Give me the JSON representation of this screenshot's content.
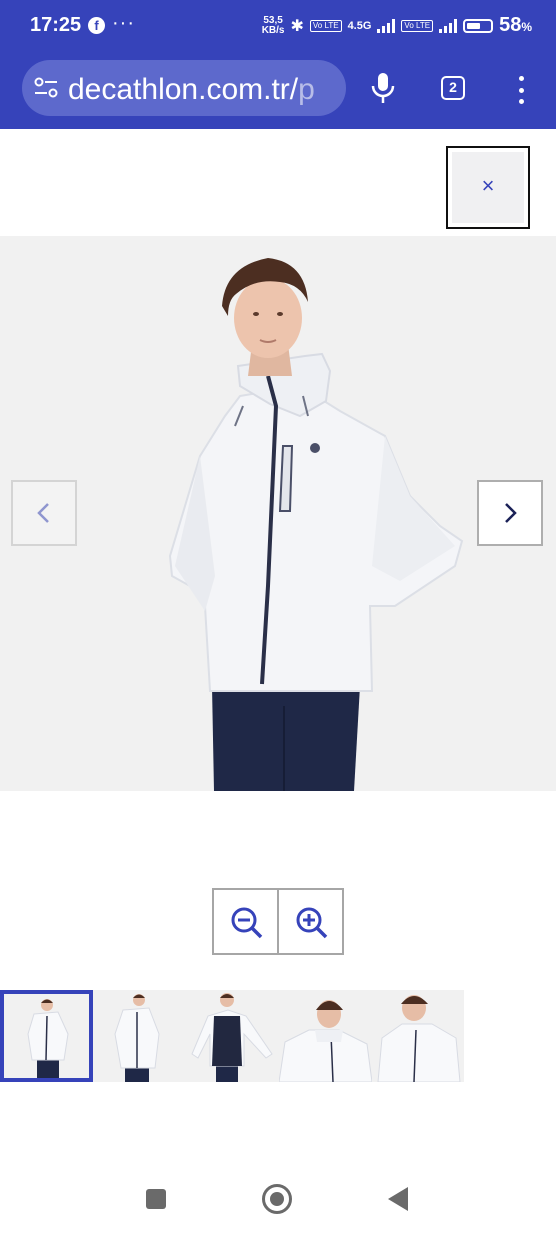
{
  "status_bar": {
    "time": "17:25",
    "facebook_glyph": "f",
    "more_dots": "···",
    "net_speed_top": "53,5",
    "net_speed_unit": "KB/s",
    "volte1": "Vo LTE",
    "network_type": "4.5G",
    "volte2": "Vo LTE",
    "battery_percent": "58",
    "battery_symbol": "%",
    "battery_level": 0.58
  },
  "browser": {
    "url_host": "decathlon.com.tr/",
    "url_path": "p",
    "tab_count": "2"
  },
  "viewer": {
    "close_glyph": "×",
    "prev_glyph": "‹",
    "next_glyph": "›"
  },
  "thumbnails": [
    {
      "name": "front",
      "active": true
    },
    {
      "name": "front-side",
      "active": false
    },
    {
      "name": "open",
      "active": false
    },
    {
      "name": "collar-closeup",
      "active": false
    },
    {
      "name": "side",
      "active": false
    }
  ],
  "colors": {
    "brand": "#3643ba",
    "jacket": "#f4f5f8",
    "pants": "#1f2847"
  }
}
